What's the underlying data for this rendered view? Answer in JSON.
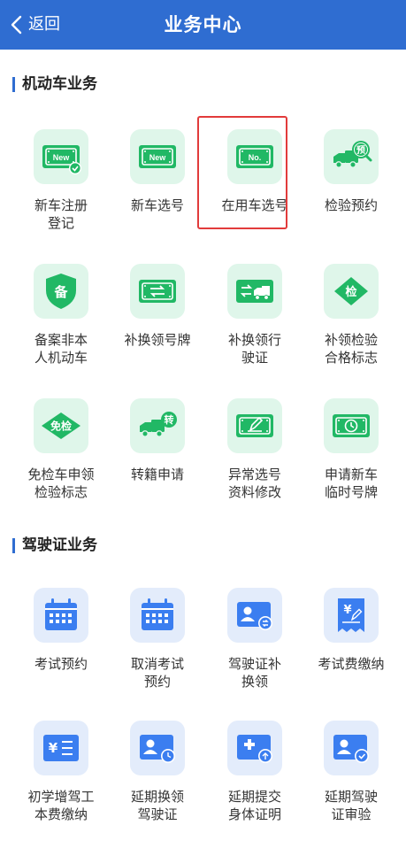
{
  "header": {
    "back_label": "返回",
    "title": "业务中心"
  },
  "sections": [
    {
      "title": "机动车业务",
      "items": [
        {
          "label": "新车注册\n登记",
          "icon": "new-plate-check-icon"
        },
        {
          "label": "新车选号",
          "icon": "new-plate-icon"
        },
        {
          "label": "在用车选号",
          "icon": "no-plate-icon",
          "selected": true
        },
        {
          "label": "检验预约",
          "icon": "truck-appointment-icon"
        },
        {
          "label": "备案非本\n人机动车",
          "icon": "shield-record-icon"
        },
        {
          "label": "补换领号牌",
          "icon": "plate-swap-icon"
        },
        {
          "label": "补换领行\n驶证",
          "icon": "vehicle-license-swap-icon"
        },
        {
          "label": "补领检验\n合格标志",
          "icon": "inspection-mark-icon"
        },
        {
          "label": "免检车申领\n检验标志",
          "icon": "exempt-mark-icon"
        },
        {
          "label": "转籍申请",
          "icon": "truck-transfer-icon"
        },
        {
          "label": "异常选号\n资料修改",
          "icon": "plate-edit-icon"
        },
        {
          "label": "申请新车\n临时号牌",
          "icon": "temporary-plate-clock-icon"
        }
      ]
    },
    {
      "title": "驾驶证业务",
      "items": [
        {
          "label": "考试预约",
          "icon": "calendar-icon"
        },
        {
          "label": "取消考试\n预约",
          "icon": "calendar-cancel-icon"
        },
        {
          "label": "驾驶证补\n换领",
          "icon": "license-swap-icon"
        },
        {
          "label": "考试费缴纳",
          "icon": "fee-receipt-icon"
        },
        {
          "label": "初学增驾工\n本费缴纳",
          "icon": "fee-list-icon"
        },
        {
          "label": "延期换领\n驾驶证",
          "icon": "license-clock-icon"
        },
        {
          "label": "延期提交\n身体证明",
          "icon": "medical-upload-icon"
        },
        {
          "label": "延期驾驶\n证审验",
          "icon": "license-check-icon"
        }
      ]
    }
  ],
  "icon_text": {
    "new": "New",
    "no": "No.",
    "yu": "预",
    "bei": "备",
    "jian": "检",
    "mianjian": "免检",
    "zhuan": "转",
    "yen": "¥"
  },
  "colors": {
    "header_bg": "#2f6dd1",
    "green": "#21b865",
    "green_bg": "#dff6ea",
    "blue": "#3b7ef0",
    "blue_bg": "#e3ecfb",
    "selected_border": "#e23b3b"
  }
}
